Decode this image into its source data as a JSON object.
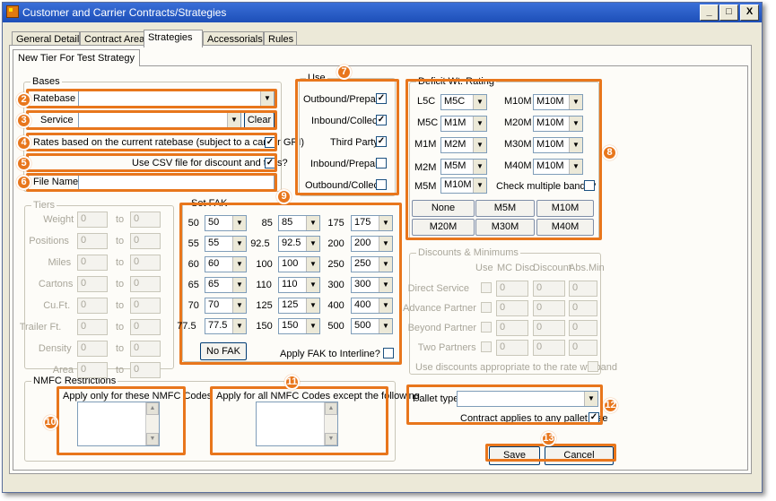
{
  "window": {
    "title": "Customer and Carrier Contracts/Strategies",
    "min": "_",
    "max": "□",
    "close": "X"
  },
  "tabs": [
    "General Details",
    "Contract Areas",
    "Strategies",
    "Accessorials",
    "Rules"
  ],
  "subtab": "New Tier For Test Strategy",
  "bases": {
    "legend": "Bases",
    "ratebase_label": "Ratebase",
    "ratebase_value": "",
    "service_label": "Service",
    "service_value": "",
    "clear": "Clear",
    "rates_based": "Rates based on the current ratebase (subject to a carrier GRI)",
    "rates_based_checked": "✓",
    "use_csv": "Use CSV file for discount and tiers?",
    "use_csv_checked": "✓",
    "file_name_label": "File Name",
    "file_name_value": ""
  },
  "use": {
    "legend": "Use",
    "items": [
      {
        "label": "Outbound/Prepaid",
        "checked": "✓"
      },
      {
        "label": "Inbound/Collect",
        "checked": "✓"
      },
      {
        "label": "Third Party",
        "checked": "✓"
      },
      {
        "label": "Inbound/Prepaid",
        "checked": ""
      },
      {
        "label": "Outbound/Collect",
        "checked": ""
      }
    ]
  },
  "deficit": {
    "legend": "Deficit Wt. Rating",
    "left": [
      {
        "label": "L5C",
        "value": "M5C"
      },
      {
        "label": "M5C",
        "value": "M1M"
      },
      {
        "label": "M1M",
        "value": "M2M"
      },
      {
        "label": "M2M",
        "value": "M5M"
      },
      {
        "label": "M5M",
        "value": "M10M"
      }
    ],
    "right": [
      {
        "label": "M10M",
        "value": "M10M"
      },
      {
        "label": "M20M",
        "value": "M10M"
      },
      {
        "label": "M30M",
        "value": "M10M"
      },
      {
        "label": "M40M",
        "value": "M10M"
      }
    ],
    "check_multiple": "Check multiple bands?",
    "check_multiple_checked": "",
    "buttons": [
      "None",
      "M5M",
      "M10M",
      "M20M",
      "M30M",
      "M40M"
    ]
  },
  "tiers": {
    "legend": "Tiers",
    "to": "to",
    "rows": [
      {
        "label": "Weight",
        "from": "0",
        "to": "0"
      },
      {
        "label": "Positions",
        "from": "0",
        "to": "0"
      },
      {
        "label": "Miles",
        "from": "0",
        "to": "0"
      },
      {
        "label": "Cartons",
        "from": "0",
        "to": "0"
      },
      {
        "label": "Cu.Ft.",
        "from": "0",
        "to": "0"
      },
      {
        "label": "Trailer Ft.",
        "from": "0",
        "to": "0"
      },
      {
        "label": "Density",
        "from": "0",
        "to": "0"
      },
      {
        "label": "Area",
        "from": "0",
        "to": "0"
      }
    ]
  },
  "fak": {
    "legend": "Set FAK",
    "rows": [
      [
        {
          "label": "50",
          "value": "50"
        },
        {
          "label": "85",
          "value": "85"
        },
        {
          "label": "175",
          "value": "175"
        }
      ],
      [
        {
          "label": "55",
          "value": "55"
        },
        {
          "label": "92.5",
          "value": "92.5"
        },
        {
          "label": "200",
          "value": "200"
        }
      ],
      [
        {
          "label": "60",
          "value": "60"
        },
        {
          "label": "100",
          "value": "100"
        },
        {
          "label": "250",
          "value": "250"
        }
      ],
      [
        {
          "label": "65",
          "value": "65"
        },
        {
          "label": "110",
          "value": "110"
        },
        {
          "label": "300",
          "value": "300"
        }
      ],
      [
        {
          "label": "70",
          "value": "70"
        },
        {
          "label": "125",
          "value": "125"
        },
        {
          "label": "400",
          "value": "400"
        }
      ],
      [
        {
          "label": "77.5",
          "value": "77.5"
        },
        {
          "label": "150",
          "value": "150"
        },
        {
          "label": "500",
          "value": "500"
        }
      ]
    ],
    "no_fak": "No FAK",
    "apply_interline": "Apply FAK to Interline?",
    "apply_interline_checked": ""
  },
  "discounts": {
    "legend": "Discounts & Minimums",
    "headers": [
      "Use",
      "MC Disc",
      "Discount",
      "Abs.Min"
    ],
    "rows": [
      {
        "label": "Direct Service",
        "mc": "0",
        "disc": "0",
        "min": "0"
      },
      {
        "label": "Advance Partner",
        "mc": "0",
        "disc": "0",
        "min": "0"
      },
      {
        "label": "Beyond Partner",
        "mc": "0",
        "disc": "0",
        "min": "0"
      },
      {
        "label": "Two Partners",
        "mc": "0",
        "disc": "0",
        "min": "0"
      }
    ],
    "use_discounts": "Use discounts appropriate to the rate wt. band"
  },
  "nmfc": {
    "legend": "NMFC Restrictions",
    "apply_only": "Apply only for these NMFC Codes",
    "apply_except": "Apply for all NMFC Codes except the following"
  },
  "pallet": {
    "label": "Pallet type",
    "value": "",
    "contract_any": "Contract applies to any pallet size",
    "contract_any_checked": "✓"
  },
  "actions": {
    "save": "Save",
    "cancel": "Cancel"
  },
  "callouts": [
    "2",
    "3",
    "4",
    "5",
    "6",
    "7",
    "8",
    "9",
    "10",
    "11",
    "12",
    "13"
  ],
  "colors": {
    "accent": "#e8761c",
    "title_bar": "#1d4fb8"
  }
}
